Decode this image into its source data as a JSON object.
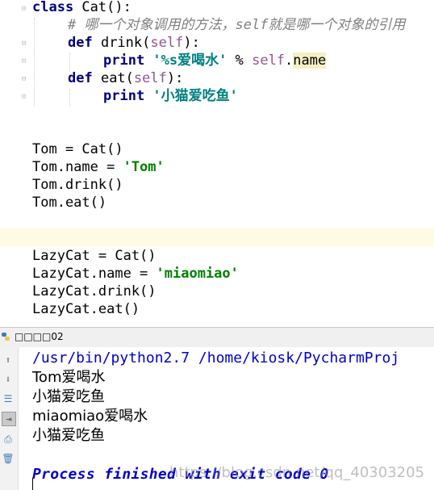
{
  "editor": {
    "lines": {
      "l1_kw": "class",
      "l1_rest": " Cat():",
      "l2_comment": "# 哪一个对象调用的方法，self就是哪一个对象的引用",
      "l3_kw": "def",
      "l3_fn": " drink(",
      "l3_self": "self",
      "l3_end": "):",
      "l4_kw": "print",
      "l4_str": " '%s爱喝水'",
      "l4_op": " % ",
      "l4_self": "self",
      "l4_dot": ".",
      "l4_attr": "name",
      "l5_kw": "def",
      "l5_fn": " eat(",
      "l5_self": "self",
      "l5_end": "):",
      "l6_kw": "print",
      "l6_str": " '小猫爱吃鱼'",
      "l7": "Tom = Cat()",
      "l8_pre": "Tom.name = ",
      "l8_str": "'Tom'",
      "l9": "Tom.drink()",
      "l10": "Tom.eat()",
      "l11": "LazyCat = Cat()",
      "l12_pre": "LazyCat.name = ",
      "l12_str": "'miaomiao'",
      "l13": "LazyCat.drink()",
      "l14": "LazyCat.eat()"
    }
  },
  "tool_window": {
    "title": "□□□□02",
    "icons": [
      "python-icon",
      "up-arrow-icon",
      "down-arrow-icon",
      "soft-wrap-icon",
      "scroll-to-end-icon",
      "print-icon",
      "trash-icon"
    ]
  },
  "console": {
    "command": "/usr/bin/python2.7 /home/kiosk/PycharmProj",
    "out1": "Tom爱喝水",
    "out2": "小猫爱吃鱼",
    "out3": "miaomiao爱喝水",
    "out4": "小猫爱吃鱼",
    "process": "Process finished with exit code 0",
    "watermark": "https://blog.csdn.net/qq_40303205"
  },
  "colors": {
    "keyword": "#000080",
    "self": "#94558d",
    "string": "#008080",
    "comment": "#808080",
    "console_blue": "#0000cc",
    "caret_row": "#fffae3"
  }
}
